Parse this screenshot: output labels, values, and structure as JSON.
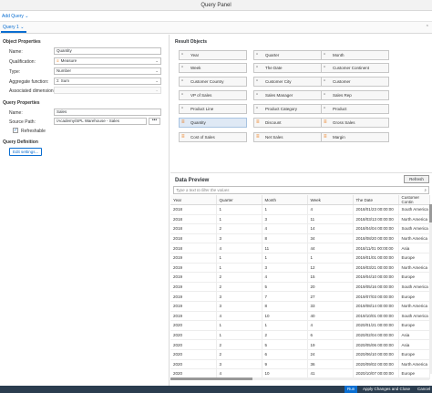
{
  "window": {
    "title": "Query Panel"
  },
  "toolbar": {
    "add_query": "Add Query",
    "add_chevron": "⌄"
  },
  "tabs": [
    {
      "label": "Query 1",
      "chevron": "⌄"
    }
  ],
  "tabbar": {
    "collapse_icon": "⌃"
  },
  "object_properties": {
    "title": "Object Properties",
    "name_label": "Name:",
    "name_value": "Quantity",
    "qualification_label": "Qualification:",
    "qualification_value": "Measure",
    "type_label": "Type:",
    "type_value": "Number",
    "aggregate_label": "Aggregate function:",
    "aggregate_value": "Sum",
    "associated_label": "Associated dimension:",
    "associated_value": ""
  },
  "query_properties": {
    "title": "Query Properties",
    "name_label": "Name:",
    "name_value": "Sales",
    "source_label": "Source Path:",
    "source_value": "/Academy/SPL Warehouse - Sales",
    "browse": "•••",
    "refreshable_label": "Refreshable",
    "refreshable_checked": "✓"
  },
  "query_definition": {
    "title": "Query Definition",
    "edit_button": "Edit settings..."
  },
  "result_objects": {
    "title": "Result Objects",
    "items": [
      {
        "label": "Year",
        "kind": "dimension"
      },
      {
        "label": "Quarter",
        "kind": "dimension"
      },
      {
        "label": "Month",
        "kind": "dimension"
      },
      {
        "label": "Week",
        "kind": "dimension"
      },
      {
        "label": "The Date",
        "kind": "dimension"
      },
      {
        "label": "Customer Continent",
        "kind": "dimension"
      },
      {
        "label": "Customer Country",
        "kind": "dimension"
      },
      {
        "label": "Customer City",
        "kind": "dimension"
      },
      {
        "label": "Customer",
        "kind": "dimension"
      },
      {
        "label": "VP of Sales",
        "kind": "dimension"
      },
      {
        "label": "Sales Manager",
        "kind": "dimension"
      },
      {
        "label": "Sales Rep",
        "kind": "dimension"
      },
      {
        "label": "Product Line",
        "kind": "dimension"
      },
      {
        "label": "Product Category",
        "kind": "dimension"
      },
      {
        "label": "Product",
        "kind": "dimension"
      },
      {
        "label": "Quantity",
        "kind": "measure",
        "selected": true
      },
      {
        "label": "Discount",
        "kind": "measure"
      },
      {
        "label": "Gross Sales",
        "kind": "measure"
      },
      {
        "label": "Cost of Sales",
        "kind": "measure"
      },
      {
        "label": "Net Sales",
        "kind": "measure"
      },
      {
        "label": "Margin",
        "kind": "measure"
      }
    ]
  },
  "data_preview": {
    "title": "Data Preview",
    "refresh_label": "Refresh",
    "filter_placeholder": "Type a text to filter the values",
    "columns": [
      "Year",
      "Quarter",
      "Month",
      "Week",
      "The Date",
      "Customer Contin"
    ],
    "rows": [
      [
        "2018",
        "1",
        "1",
        "4",
        "2018/01/23 00:00:00",
        "South America"
      ],
      [
        "2018",
        "1",
        "3",
        "11",
        "2018/03/13 00:00:00",
        "North America"
      ],
      [
        "2018",
        "2",
        "4",
        "14",
        "2018/04/04 00:00:00",
        "South America"
      ],
      [
        "2018",
        "3",
        "8",
        "34",
        "2018/08/20 00:00:00",
        "North America"
      ],
      [
        "2018",
        "4",
        "11",
        "44",
        "2018/11/01 00:00:00",
        "Asia"
      ],
      [
        "2019",
        "1",
        "1",
        "1",
        "2019/01/01 00:00:00",
        "Europe"
      ],
      [
        "2019",
        "1",
        "3",
        "12",
        "2019/03/21 00:00:00",
        "North America"
      ],
      [
        "2019",
        "2",
        "4",
        "15",
        "2019/04/10 00:00:00",
        "Europe"
      ],
      [
        "2019",
        "2",
        "5",
        "20",
        "2019/05/16 00:00:00",
        "South America"
      ],
      [
        "2019",
        "3",
        "7",
        "27",
        "2019/07/03 00:00:00",
        "Europe"
      ],
      [
        "2019",
        "3",
        "8",
        "33",
        "2019/08/14 00:00:00",
        "North America"
      ],
      [
        "2019",
        "4",
        "10",
        "40",
        "2019/10/01 00:00:00",
        "South America"
      ],
      [
        "2020",
        "1",
        "1",
        "4",
        "2020/01/21 00:00:00",
        "Europe"
      ],
      [
        "2020",
        "1",
        "2",
        "6",
        "2020/02/04 00:00:00",
        "Asia"
      ],
      [
        "2020",
        "2",
        "5",
        "19",
        "2020/05/06 00:00:00",
        "Asia"
      ],
      [
        "2020",
        "2",
        "6",
        "24",
        "2020/06/10 00:00:00",
        "Europe"
      ],
      [
        "2020",
        "3",
        "9",
        "36",
        "2020/09/02 00:00:00",
        "North America"
      ],
      [
        "2020",
        "4",
        "10",
        "41",
        "2020/10/07 00:00:00",
        "Europe"
      ]
    ]
  },
  "footer": {
    "run": "Run",
    "apply_close": "Apply Changes and Close",
    "cancel": "Cancel"
  }
}
